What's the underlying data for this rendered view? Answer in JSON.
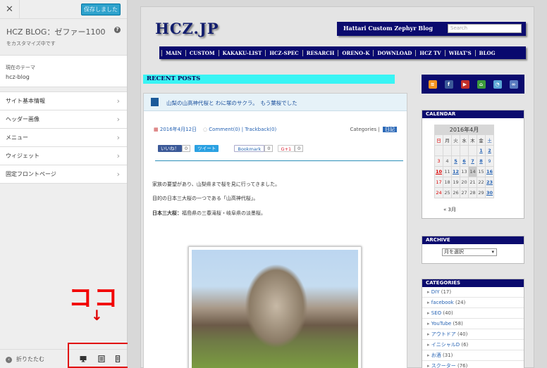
{
  "sidebar": {
    "close_glyph": "✕",
    "save_label": "保存しました",
    "site_title": "HCZ BLOG：ゼファー1100",
    "site_subtitle": "をカスタマイズ中です",
    "help_glyph": "?",
    "theme_label": "現在のテーマ",
    "theme_name": "hcz-blog",
    "menu": [
      "サイト基本情報",
      "ヘッダー画像",
      "メニュー",
      "ウィジェット",
      "固定フロントページ"
    ],
    "chevron": "›",
    "annotation": "ココ",
    "arrow": "↓",
    "collapse_label": "折りたたむ",
    "devices": [
      "desktop-icon",
      "tablet-icon",
      "mobile-icon"
    ]
  },
  "preview": {
    "logo": "HCZ.JP",
    "blog_name": "Hattari Custom Zephyr Blog",
    "search_placeholder": "Search",
    "nav": [
      "MAIN",
      "CUSTOM",
      "KAKAKU-LIST",
      "HCZ-SPEC",
      "RESARCH",
      "ORENO-K",
      "DOWNLOAD",
      "HCZ TV",
      "WHAT'S",
      "BLOG"
    ],
    "recent_posts": "RECENT POSTS",
    "post": {
      "title": "山梨の山高神代桜と わに塚のサクラ。　もう葉桜でした",
      "date": "2016年4月12日",
      "comment": "Comment(0)",
      "trackback": "Trackback(0)",
      "categories_label": "Categories",
      "category": "日記",
      "fb_label": "いいね！",
      "fb_count": "0",
      "tw_label": "ツイート",
      "bm_label": "Bookmark",
      "bm_count": "0",
      "gp_label": "G+1",
      "gp_count": "0",
      "para1": "家族の要望があり、山梨県まで桜を見に行ってきました。",
      "para2": "目的の日本三大桜の一つである「山高神代桜」。",
      "para3_bold": "日本三大桜：",
      "para3": "福島県の三春滝桜・岐阜県の淡墨桜。"
    },
    "calendar": {
      "title": "CALENDAR",
      "month": "2016年4月",
      "weekdays": [
        "日",
        "月",
        "火",
        "水",
        "木",
        "金",
        "土"
      ],
      "weeks": [
        [
          "",
          "",
          "",
          "",
          "",
          "1",
          "2"
        ],
        [
          "3",
          "4",
          "5",
          "6",
          "7",
          "8",
          "9"
        ],
        [
          "10",
          "11",
          "12",
          "13",
          "14",
          "15",
          "16"
        ],
        [
          "17",
          "18",
          "19",
          "20",
          "21",
          "22",
          "23"
        ],
        [
          "24",
          "25",
          "26",
          "27",
          "28",
          "29",
          "30"
        ]
      ],
      "linked_days": [
        "1",
        "2",
        "5",
        "6",
        "7",
        "8",
        "10",
        "12",
        "16",
        "23",
        "30"
      ],
      "prev": "« 3月"
    },
    "archive": {
      "title": "ARCHIVE",
      "select": "月を選択"
    },
    "categories": {
      "title": "CATEGORIES",
      "items": [
        {
          "name": "DIY",
          "count": "(17)"
        },
        {
          "name": "facebook",
          "count": "(24)"
        },
        {
          "name": "SEO",
          "count": "(40)"
        },
        {
          "name": "YouTube",
          "count": "(58)"
        },
        {
          "name": "アウトドア",
          "count": "(40)"
        },
        {
          "name": "イニシャルD",
          "count": "(6)"
        },
        {
          "name": "お酒",
          "count": "(31)"
        },
        {
          "name": "スクーター",
          "count": "(76)"
        }
      ]
    },
    "colors": {
      "nav_bg": "#08086e",
      "recent_bg": "#39f4f4",
      "link": "#2864b4",
      "annotation": "#f20000"
    }
  }
}
